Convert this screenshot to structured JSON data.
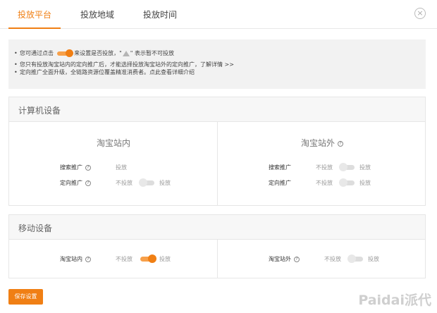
{
  "tabs": [
    {
      "label": "投放平台",
      "active": true
    },
    {
      "label": "投放地域",
      "active": false
    },
    {
      "label": "投放时间",
      "active": false
    }
  ],
  "close_icon": "×",
  "notice": {
    "line1_prefix": "您可通过点击",
    "line1_middle": "来设置是否投放，\"",
    "line1_suffix": "\" 表示暂不可投放",
    "line2": "您只有投放淘宝站内的定向推广后，才能选择投放淘宝站外的定向推广，",
    "line2_link": "了解详情 >>",
    "line3": "定向推广全面升级，全链路资源位覆盖精准消费者。点此查看详细介绍"
  },
  "computer": {
    "title": "计算机设备",
    "inside_title": "淘宝站内",
    "outside_title": "淘宝站外",
    "inside_rows": [
      {
        "label": "搜索推广",
        "value": "投放"
      },
      {
        "label": "定向推广",
        "off": "不投放",
        "on": "投放",
        "enabled": false
      }
    ],
    "outside_rows": [
      {
        "label": "搜索推广",
        "off": "不投放",
        "on": "投放",
        "enabled": false
      },
      {
        "label": "定向推广",
        "off": "不投放",
        "on": "投放",
        "enabled": false
      }
    ]
  },
  "mobile": {
    "title": "移动设备",
    "inside": {
      "label": "淘宝站内",
      "off": "不投放",
      "on": "投放",
      "enabled": true
    },
    "outside": {
      "label": "淘宝站外",
      "off": "不投放",
      "on": "投放",
      "enabled": false
    }
  },
  "help_glyph": "?",
  "save_button": "保存设置",
  "watermark": "Paidai派代",
  "colors": {
    "accent": "#f07f14"
  }
}
